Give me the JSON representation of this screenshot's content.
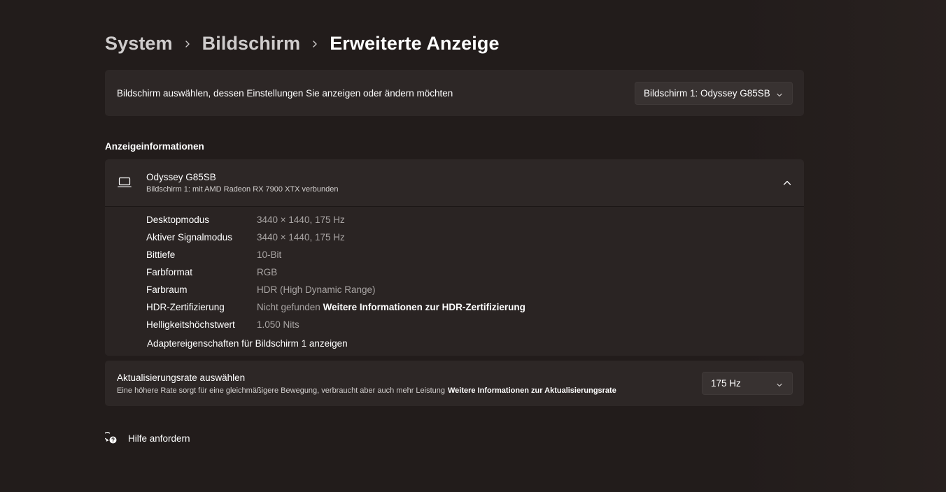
{
  "breadcrumb": {
    "items": [
      "System",
      "Bildschirm",
      "Erweiterte Anzeige"
    ]
  },
  "display_select": {
    "label": "Bildschirm auswählen, dessen Einstellungen Sie anzeigen oder ändern möchten",
    "value": "Bildschirm 1: Odyssey G85SB"
  },
  "section_title": "Anzeigeinformationen",
  "display_info": {
    "name": "Odyssey G85SB",
    "subtitle": "Bildschirm 1: mit AMD Radeon RX 7900 XTX verbunden",
    "rows": [
      {
        "key": "Desktopmodus",
        "value": "3440 × 1440, 175 Hz"
      },
      {
        "key": "Aktiver Signalmodus",
        "value": "3440 × 1440, 175 Hz"
      },
      {
        "key": "Bittiefe",
        "value": "10-Bit"
      },
      {
        "key": "Farbformat",
        "value": "RGB"
      },
      {
        "key": "Farbraum",
        "value": "HDR (High Dynamic Range)"
      },
      {
        "key": "HDR-Zertifizierung",
        "value": "Nicht gefunden",
        "link": "Weitere Informationen zur HDR-Zertifizierung"
      },
      {
        "key": "Helligkeitshöchstwert",
        "value": "1.050 Nits"
      }
    ],
    "adapter_link": "Adaptereigenschaften für Bildschirm 1 anzeigen"
  },
  "refresh": {
    "title": "Aktualisierungsrate auswählen",
    "subtitle": "Eine höhere Rate sorgt für eine gleichmäßigere Bewegung, verbraucht aber auch mehr Leistung",
    "link": "Weitere Informationen zur Aktualisierungsrate",
    "value": "175 Hz"
  },
  "help": {
    "label": "Hilfe anfordern"
  },
  "icons": {
    "breadcrumb_separator": "chevron-right-icon",
    "dropdown": "chevron-down-icon",
    "monitor": "laptop-icon",
    "collapse": "chevron-up-icon",
    "help": "help-chat-icon"
  },
  "colors": {
    "background": "#221c1b",
    "card": "#2d2726",
    "text_primary": "#ffffff",
    "text_secondary": "#a9a5a4"
  }
}
